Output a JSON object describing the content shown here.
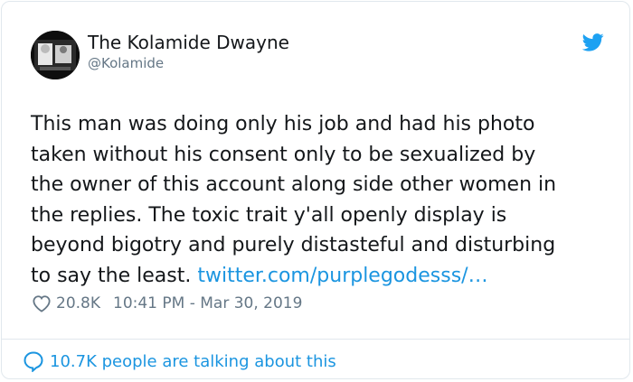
{
  "author": {
    "display_name": "The Kolamide Dwayne",
    "handle": "@Kolamide",
    "avatar_icon": "profile-photo"
  },
  "platform_icon": "twitter-bird-icon",
  "tweet": {
    "lines": [
      "This man was doing only his job and had his photo",
      "taken without his consent only to be sexualized by",
      "the owner of this account along side other women in",
      "the replies. The toxic trait y'all openly display is",
      "beyond bigotry and purely distasteful and disturbing",
      "to say the least."
    ],
    "link_text": "twitter.com/purplegodesss/…"
  },
  "meta": {
    "likes": "20.8K",
    "timestamp": "10:41 PM - Mar 30, 2019"
  },
  "footer": {
    "talking_text": "10.7K people are talking about this"
  },
  "colors": {
    "link": "#1b95e0",
    "secondary_text": "#657786",
    "primary_text": "#14171a",
    "border": "#e1e8ed"
  }
}
